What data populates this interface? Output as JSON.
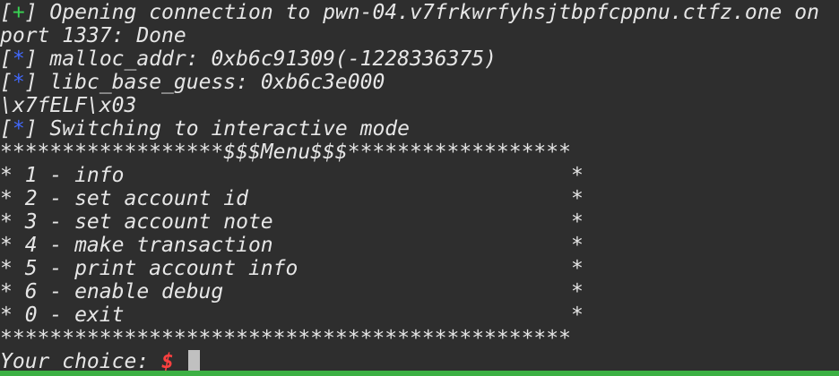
{
  "terminal": {
    "conn_line_1": " Opening connection to pwn-04.v7frkwrfyhsjtbpfcppnu.ctfz.one on",
    "conn_line_2": "port 1337: Done",
    "malloc": " malloc_addr: 0xb6c91309(-1228336375)",
    "libc": " libc_base_guess: 0xb6c3e000",
    "elf": "\\x7fELF\\x03",
    "interactive": " Switching to interactive mode",
    "status_plus": "+",
    "status_star": "*",
    "bracket_open": "[",
    "bracket_close": "]"
  },
  "menu": {
    "header": "******************$$$Menu$$$******************",
    "items": [
      "* 1 - info                                    *",
      "* 2 - set account id                          *",
      "* 3 - set account note                        *",
      "* 4 - make transaction                        *",
      "* 5 - print account info                      *",
      "* 6 - enable debug                            *",
      "* 0 - exit                                    *"
    ],
    "footer": "**********************************************"
  },
  "prompt": {
    "label": "Your choice: ",
    "symbol": "$"
  },
  "colors": {
    "background": "#2e2e2e",
    "text": "#e6e6e6",
    "success": "#39d353",
    "info": "#4169ff",
    "prompt_symbol": "#ff4040",
    "statusbar": "#3cb043"
  }
}
